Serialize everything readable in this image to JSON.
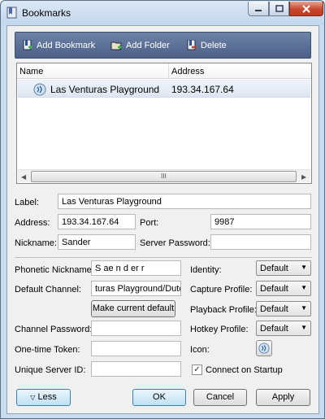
{
  "window": {
    "title": "Bookmarks",
    "icons": {
      "app": "bookmark-icon",
      "min": "minimize-icon",
      "max": "maximize-icon",
      "close": "close-icon"
    }
  },
  "toolbar": {
    "add_bookmark": "Add Bookmark",
    "add_folder": "Add Folder",
    "delete": "Delete"
  },
  "list": {
    "columns": [
      "Name",
      "Address"
    ],
    "rows": [
      {
        "name": "Las Venturas Playground",
        "address": "193.34.167.64",
        "icon": "server-icon"
      }
    ],
    "scroll_grip": "III"
  },
  "form": {
    "label_label": "Label:",
    "label_value": "Las Venturas Playground",
    "address_label": "Address:",
    "address_value": "193.34.167.64",
    "port_label": "Port:",
    "port_value": "9987",
    "nickname_label": "Nickname:",
    "nickname_value": "Sander",
    "server_password_label": "Server Password:",
    "server_password_value": ""
  },
  "advanced": {
    "phonetic_label": "Phonetic Nickname:",
    "phonetic_value": "S ae n d er r",
    "default_channel_label": "Default Channel:",
    "default_channel_value": "turas Playground/Dutch",
    "make_default_button": "Make current default",
    "channel_password_label": "Channel Password:",
    "channel_password_value": "",
    "one_time_token_label": "One-time Token:",
    "one_time_token_value": "",
    "unique_id_label": "Unique Server ID:",
    "unique_id_value": "",
    "identity_label": "Identity:",
    "identity_value": "Default",
    "capture_label": "Capture Profile:",
    "capture_value": "Default",
    "playback_label": "Playback Profile:",
    "playback_value": "Default",
    "hotkey_label": "Hotkey Profile:",
    "hotkey_value": "Default",
    "icon_label": "Icon:",
    "connect_label": "Connect on Startup",
    "connect_checked": true
  },
  "buttons": {
    "less": "Less",
    "ok": "OK",
    "cancel": "Cancel",
    "apply": "Apply"
  },
  "colors": {
    "toolbar": "#5a6e95",
    "selected_row": "#e3eaf3",
    "accent_button": "#bfe1f6"
  }
}
